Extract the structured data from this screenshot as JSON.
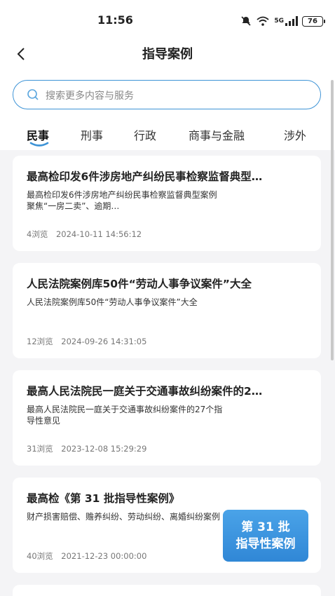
{
  "status_bar": {
    "time": "11:56",
    "signal_label": "5G",
    "battery": "76"
  },
  "header": {
    "title": "指导案例"
  },
  "search": {
    "placeholder": "搜索更多内容与服务"
  },
  "tabs": [
    {
      "label": "民事",
      "active": true
    },
    {
      "label": "刑事",
      "active": false
    },
    {
      "label": "行政",
      "active": false
    },
    {
      "label": "商事与金融",
      "active": false
    },
    {
      "label": "涉外",
      "active": false
    }
  ],
  "cards": [
    {
      "title": "最高检印发6件涉房地产纠纷民事检察监督典型…",
      "summary": "最高检印发6件涉房地产纠纷民事检察监督典型案例 聚焦“一房二卖”、逾期…",
      "views": "4浏览",
      "date": "2024-10-11 14:56:12"
    },
    {
      "title": "人民法院案例库50件“劳动人事争议案件”大全",
      "summary": "人民法院案例库50件“劳动人事争议案件”大全",
      "views": "12浏览",
      "date": "2024-09-26 14:31:05"
    },
    {
      "title": "最高人民法院民一庭关于交通事故纠纷案件的2…",
      "summary": "最高人民法院民一庭关于交通事故纠纷案件的27个指导性意见",
      "views": "31浏览",
      "date": "2023-12-08 15:29:29"
    },
    {
      "title": "最高检《第 31 批指导性案例》",
      "summary": "财产损害赔偿、赡养纠纷、劳动纠纷、离婚纠纷案例",
      "views": "40浏览",
      "date": "2021-12-23 00:00:00",
      "badge_line1": "第 31 批",
      "badge_line2": "指导性案例"
    }
  ],
  "colors": {
    "accent": "#3d93d6",
    "background": "#f4f4f6"
  }
}
